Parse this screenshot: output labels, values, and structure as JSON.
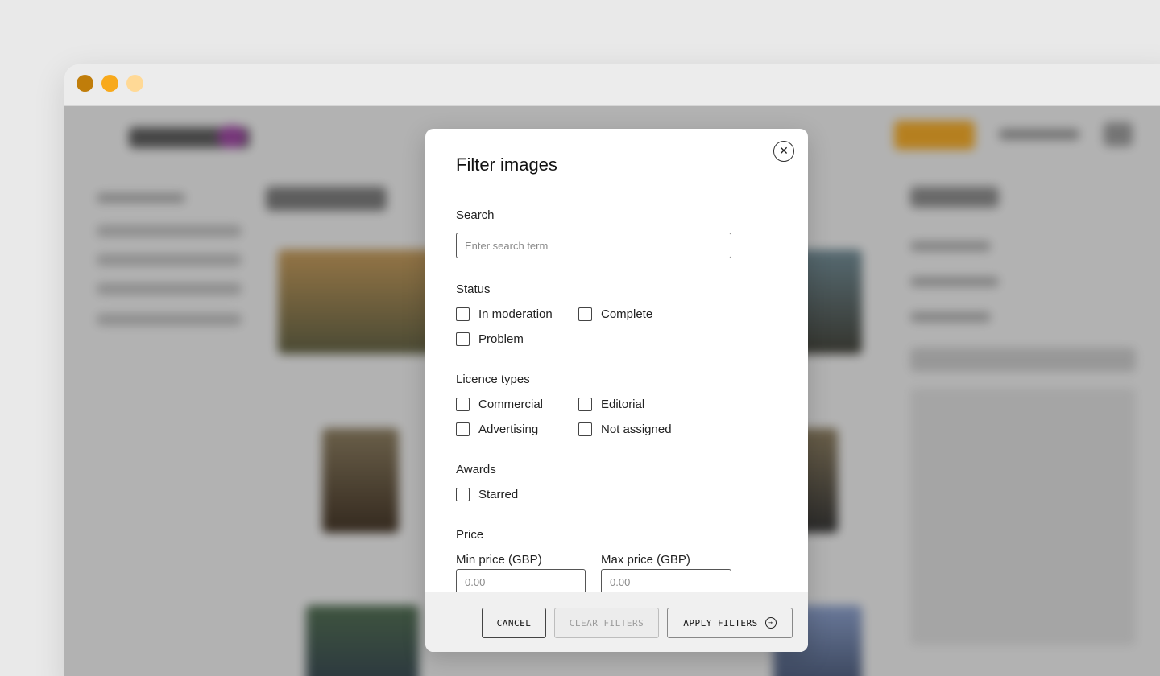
{
  "modal": {
    "title": "Filter images",
    "close_icon": "close-icon",
    "search": {
      "label": "Search",
      "placeholder": "Enter search term",
      "value": ""
    },
    "status": {
      "label": "Status",
      "options": [
        "In moderation",
        "Complete",
        "Problem"
      ]
    },
    "licence_types": {
      "label": "Licence types",
      "options": [
        "Commercial",
        "Editorial",
        "Advertising",
        "Not assigned"
      ]
    },
    "awards": {
      "label": "Awards",
      "options": [
        "Starred"
      ]
    },
    "price": {
      "label": "Price",
      "min_label": "Min price (GBP)",
      "min_placeholder": "0.00",
      "max_label": "Max price (GBP)",
      "max_placeholder": "0.00"
    },
    "footer": {
      "cancel": "CANCEL",
      "clear": "CLEAR FILTERS",
      "apply": "APPLY FILTERS",
      "apply_icon": "arrow-right-circle-icon"
    }
  },
  "colors": {
    "accent": "#f8a91b",
    "overlay": "#282828"
  }
}
